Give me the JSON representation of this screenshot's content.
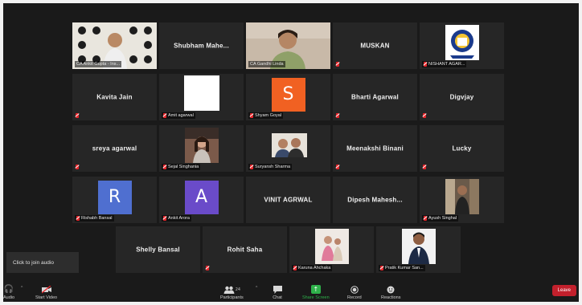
{
  "participants": [
    {
      "id": "p1",
      "label": "CA Ankit Gupta - Ins...",
      "muted": false,
      "kind": "video",
      "active": true
    },
    {
      "id": "p2",
      "name": "Shubham Mahe...",
      "muted": false,
      "kind": "name"
    },
    {
      "id": "p3",
      "label": "CA Gandhi Linda",
      "muted": false,
      "kind": "video"
    },
    {
      "id": "p4",
      "name": "MUSKAN",
      "muted": true,
      "kind": "name"
    },
    {
      "id": "p5",
      "label": "NISHANT AGAR...",
      "muted": true,
      "kind": "logo"
    },
    {
      "id": "p6",
      "name": "Kavita Jain",
      "muted": true,
      "kind": "name"
    },
    {
      "id": "p7",
      "label": "Amit agarwal",
      "muted": true,
      "kind": "white"
    },
    {
      "id": "p8",
      "label": "Shyam Goyal",
      "muted": true,
      "kind": "avatar",
      "letter": "S",
      "color": "#f16122"
    },
    {
      "id": "p9",
      "name": "Bharti Agarwal",
      "muted": true,
      "kind": "name"
    },
    {
      "id": "p10",
      "name": "Digvjay",
      "muted": true,
      "kind": "name"
    },
    {
      "id": "p11",
      "name": "sreya agarwal",
      "muted": true,
      "kind": "name"
    },
    {
      "id": "p12",
      "label": "Sejal Singhania",
      "muted": true,
      "kind": "photo"
    },
    {
      "id": "p13",
      "label": "Suryansh Sharma",
      "muted": true,
      "kind": "photo"
    },
    {
      "id": "p14",
      "name": "Meenakshi Binani",
      "muted": true,
      "kind": "name"
    },
    {
      "id": "p15",
      "name": "Lucky",
      "muted": true,
      "kind": "name"
    },
    {
      "id": "p16",
      "label": "Rishabh Bansal",
      "muted": true,
      "kind": "avatar",
      "letter": "R",
      "color": "#4f6fd0"
    },
    {
      "id": "p17",
      "label": "Ankit Arora",
      "muted": true,
      "kind": "avatar",
      "letter": "A",
      "color": "#6a4bc9"
    },
    {
      "id": "p18",
      "name": "VINIT AGRWAL",
      "muted": false,
      "kind": "name"
    },
    {
      "id": "p19",
      "name": "Dipesh Mahesh...",
      "muted": false,
      "kind": "name"
    },
    {
      "id": "p20",
      "label": "Ayush Singhal",
      "muted": true,
      "kind": "photo"
    },
    {
      "id": "p21",
      "name": "Shelly Bansal",
      "muted": false,
      "kind": "name"
    },
    {
      "id": "p22",
      "name": "Rohit Saha",
      "muted": true,
      "kind": "name"
    },
    {
      "id": "p23",
      "label": "Karuna Ahchaka",
      "muted": true,
      "kind": "photo"
    },
    {
      "id": "p24",
      "label": "Pratik Kumar San...",
      "muted": true,
      "kind": "photo"
    }
  ],
  "join_audio": "Click to join audio",
  "toolbar": {
    "audio": "Audio",
    "start_video": "Start Video",
    "participants": "Participants",
    "participants_count": "24",
    "chat": "Chat",
    "share_screen": "Share Screen",
    "record": "Record",
    "reactions": "Reactions",
    "leave": "Leave"
  },
  "colors": {
    "active_border": "#c6ec5a",
    "share": "#2eb24a",
    "leave": "#c2202c",
    "mute": "#e8262b"
  }
}
